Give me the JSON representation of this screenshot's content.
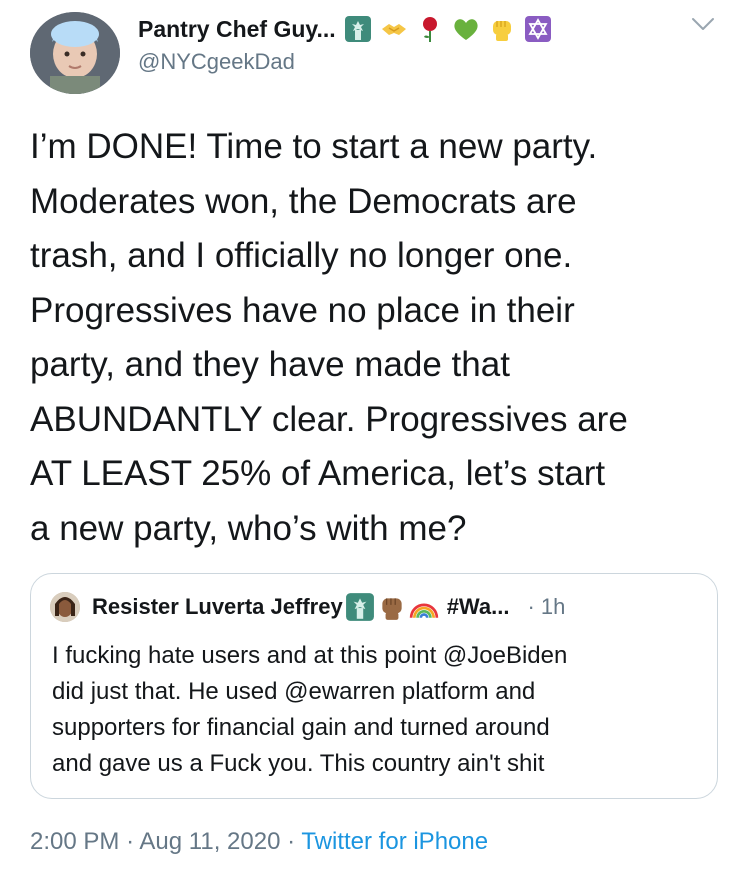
{
  "author": {
    "display_name": "Pantry Chef Guy...",
    "handle": "@NYCgeekDad",
    "badge_icons": [
      "statue-of-liberty-icon",
      "handshake-icon",
      "rose-icon",
      "green-heart-icon",
      "raised-fist-icon",
      "star-of-david-icon"
    ]
  },
  "tweet": {
    "text": "I’m DONE! Time to start a new party.\nModerates won, the Democrats are\ntrash, and I officially no longer one.\nProgressives have no place in their\nparty, and they have made that\nABUNDANTLY clear. Progressives are\nAT LEAST 25% of America, let’s start\na new party, who’s with me?"
  },
  "quoted_tweet": {
    "display_name": "Resister Luverta Jeffrey",
    "badge_icons": [
      "statue-of-liberty-icon",
      "raised-fist-icon",
      "rainbow-icon"
    ],
    "hashtag_truncated": "#Wa...",
    "separator": "·",
    "time": "1h",
    "text": "I fucking hate users and at this point @JoeBiden\ndid just that. He used @ewarren platform and\nsupporters for financial gain and turned around\nand gave us a Fuck you. This country ain't shit"
  },
  "footer": {
    "time": "2:00 PM",
    "sep1": "·",
    "date": "Aug 11, 2020",
    "sep2": "·",
    "source": "Twitter for iPhone"
  },
  "colors": {
    "text": "#14171a",
    "secondary": "#657786",
    "link": "#1b95e0",
    "border": "#ccd6dd"
  }
}
